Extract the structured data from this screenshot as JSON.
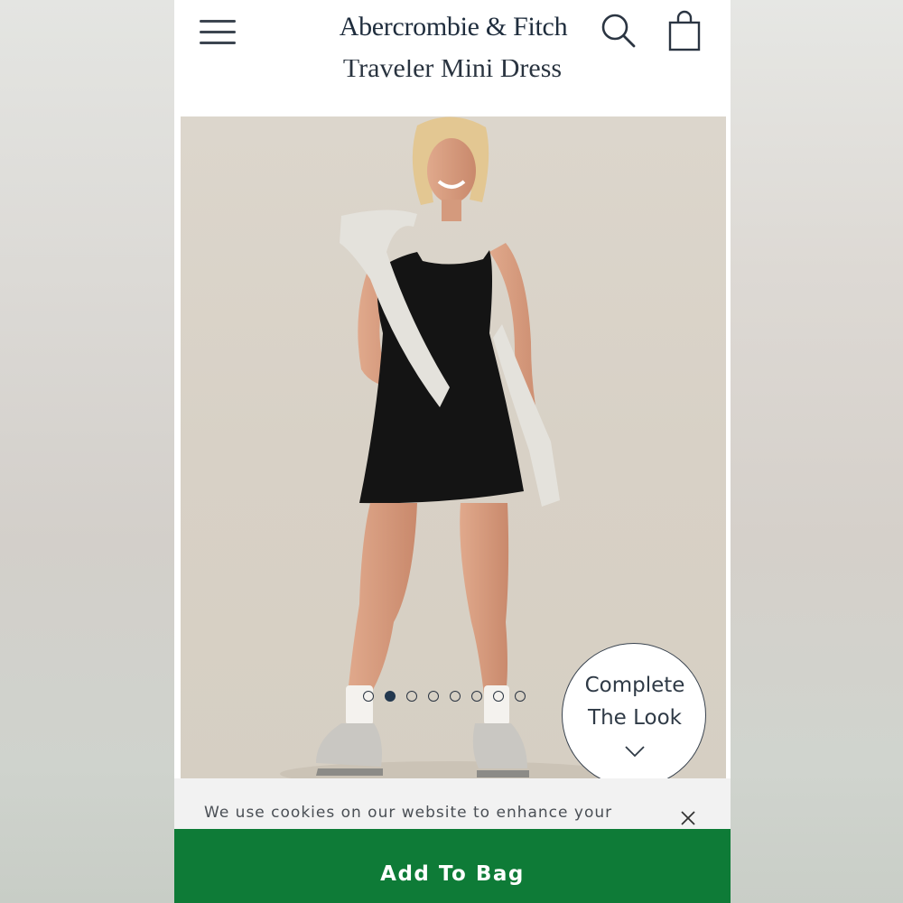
{
  "header": {
    "logo": "Abercrombie & Fitch",
    "menu_icon": "hamburger-menu-icon",
    "search_icon": "search-icon",
    "bag_icon": "shopping-bag-icon"
  },
  "product": {
    "title": "Traveler Mini Dress"
  },
  "gallery": {
    "total_slides": 8,
    "active_slide": 2
  },
  "complete_look": {
    "line1": "Complete",
    "line2": "The Look",
    "icon": "chevron-down-icon"
  },
  "cookie_banner": {
    "text": "We use cookies on our website to enhance your",
    "close_icon": "close-icon"
  },
  "cta": {
    "add_to_bag": "Add To Bag",
    "color": "#0e7b37"
  }
}
